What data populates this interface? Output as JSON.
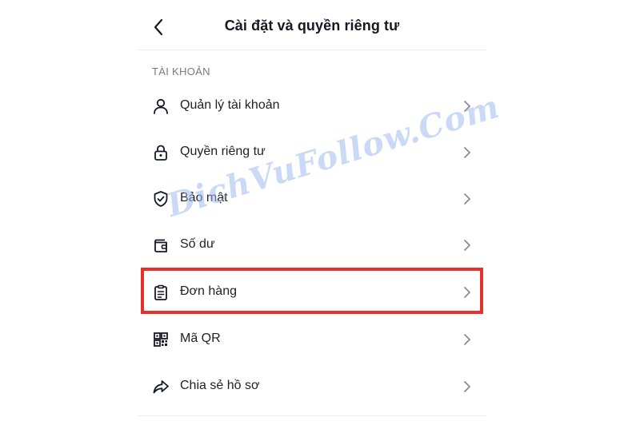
{
  "header": {
    "title": "Cài đặt và quyền riêng tư",
    "back_icon": "chevron-left-icon"
  },
  "section": {
    "label": "TÀI KHOẢN"
  },
  "items": [
    {
      "label": "Quản lý tài khoản",
      "icon": "person-icon"
    },
    {
      "label": "Quyền riêng tư",
      "icon": "lock-icon"
    },
    {
      "label": "Bảo mật",
      "icon": "shield-check-icon"
    },
    {
      "label": "Số dư",
      "icon": "wallet-icon"
    },
    {
      "label": "Đơn hàng",
      "icon": "order-list-icon",
      "highlighted": true
    },
    {
      "label": "Mã QR",
      "icon": "qr-code-icon"
    },
    {
      "label": "Chia sẻ hồ sơ",
      "icon": "share-icon"
    }
  ],
  "watermark": {
    "text": "DichVuFollow.Com"
  },
  "colors": {
    "highlight_border": "#e8312b",
    "watermark": "#9cbaee",
    "text": "#161823",
    "section_label": "#7a7a7f"
  }
}
